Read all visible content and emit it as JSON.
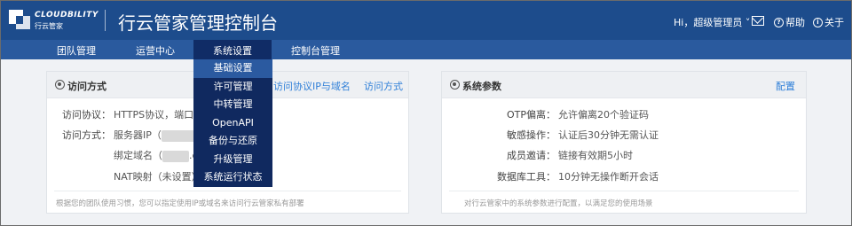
{
  "header": {
    "logo_text": "CLOUDBILITY",
    "logo_subtext": "行云管家",
    "title": "行云管家管理控制台",
    "user_label": "Hi，超级管理员",
    "help_label": "帮助",
    "about_label": "关于",
    "colors": {
      "header_bg": "#1d4c8c",
      "nav_bg": "#2a5a9e",
      "menu_bg": "#10295f",
      "link": "#2f7fd8"
    }
  },
  "nav": {
    "items": [
      {
        "label": "团队管理"
      },
      {
        "label": "运营中心"
      },
      {
        "label": "系统设置"
      },
      {
        "label": "控制台管理"
      }
    ]
  },
  "dropdown": {
    "items": [
      {
        "label": "基础设置"
      },
      {
        "label": "许可管理"
      },
      {
        "label": "中转管理"
      },
      {
        "label": "OpenAPI"
      },
      {
        "label": "备份与还原"
      },
      {
        "label": "升级管理"
      },
      {
        "label": "系统运行状态"
      }
    ]
  },
  "access_card": {
    "title": "访问方式",
    "links": [
      "访问协议",
      "IP与域名",
      "访问方式"
    ],
    "rows": [
      {
        "label": "访问协议：",
        "value": "HTTPS协议，端口44"
      },
      {
        "label": "访问方式：",
        "value": "服务器IP（",
        "value_tail": "7"
      },
      {
        "label": "绑定域名（",
        "value_tail": ".c"
      },
      {
        "label": "NAT映射（未设置）"
      }
    ],
    "footer": "根据您的团队使用习惯，您可以指定使用IP或域名来访问行云管家私有部署"
  },
  "params_card": {
    "title": "系统参数",
    "link": "配置",
    "rows": [
      {
        "label": "OTP偏离：",
        "value": "允许偏离20个验证码"
      },
      {
        "label": "敏感操作：",
        "value": "认证后30分钟无需认证"
      },
      {
        "label": "成员邀请：",
        "value": "链接有效期5小时"
      },
      {
        "label": "数据库工具：",
        "value": "10分钟无操作断开会话"
      }
    ],
    "footer": "对行云管家中的系统参数进行配置，以满足您的使用场景"
  }
}
